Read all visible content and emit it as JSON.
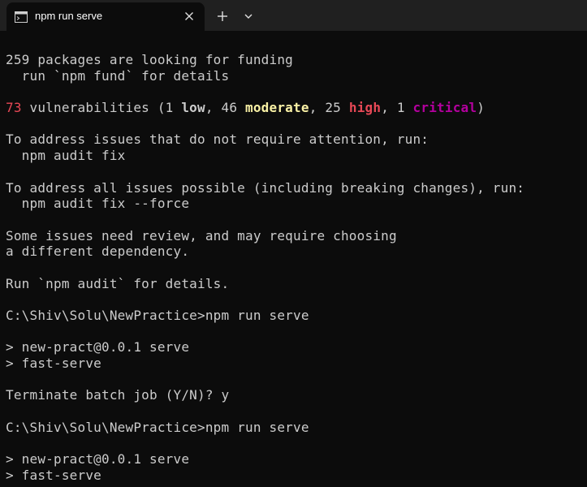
{
  "tab": {
    "title": "npm run serve",
    "icon": "terminal-icon",
    "close_icon": "close-icon"
  },
  "toolbar": {
    "new_tab_icon": "plus-icon",
    "dropdown_icon": "chevron-down-icon"
  },
  "colors": {
    "background": "#0c0c0c",
    "tabbar": "#202020",
    "text": "#cccccc",
    "red": "#e74856",
    "yellow": "#f9f1a5",
    "magenta": "#b4009e"
  },
  "terminal": {
    "line_funding": "259 packages are looking for funding",
    "line_fund_run": "  run `npm fund` for details",
    "vuln": {
      "count": "73",
      "pre": " vulnerabilities (",
      "low_count": "1 ",
      "low": "low",
      "sep1": ", 46 ",
      "moderate": "moderate",
      "sep2": ", 25 ",
      "high": "high",
      "sep3": ", 1 ",
      "critical": "critical",
      "post": ")"
    },
    "line_address1": "To address issues that do not require attention, run:",
    "line_fix": "  npm audit fix",
    "line_address2": "To address all issues possible (including breaking changes), run:",
    "line_fix_force": "  npm audit fix --force",
    "line_review1": "Some issues need review, and may require choosing",
    "line_review2": "a different dependency.",
    "line_audit": "Run `npm audit` for details.",
    "line_prompt1": "C:\\Shiv\\Solu\\NewPractice>npm run serve",
    "line_script1": "> new-pract@0.0.1 serve",
    "line_cmd1": "> fast-serve",
    "line_terminate": "Terminate batch job (Y/N)? y",
    "line_prompt2": "C:\\Shiv\\Solu\\NewPractice>npm run serve",
    "line_script2": "> new-pract@0.0.1 serve",
    "line_cmd2": "> fast-serve"
  }
}
